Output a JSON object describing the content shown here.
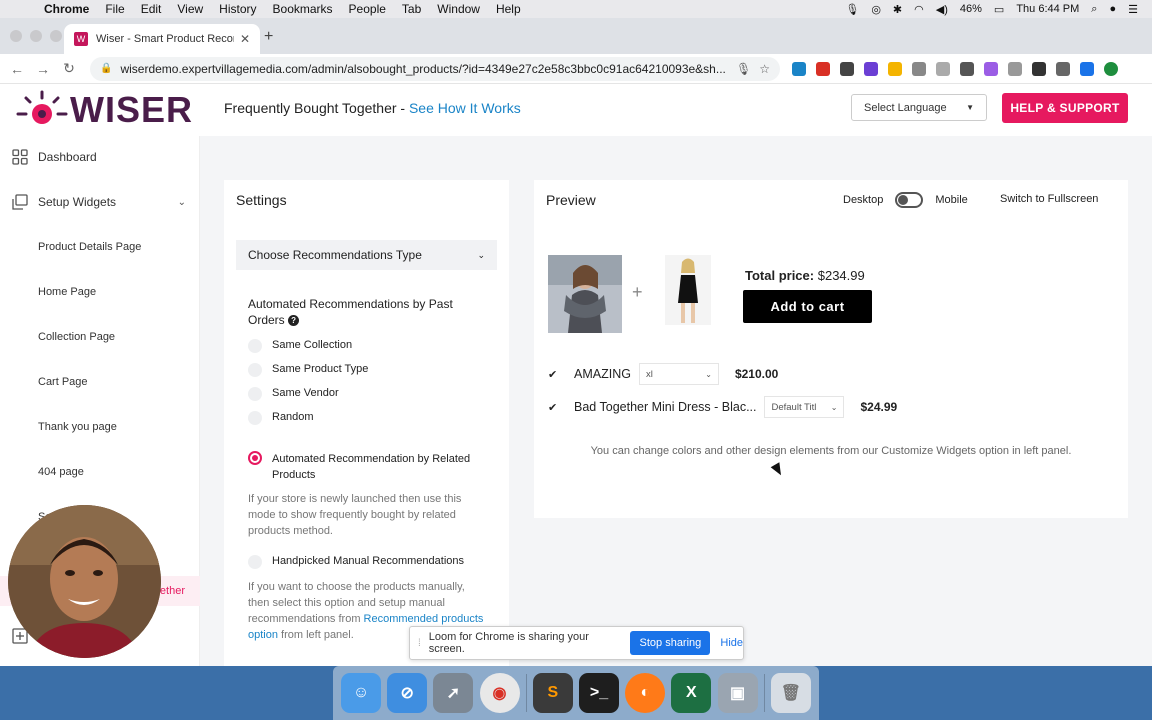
{
  "menubar": {
    "app": "Chrome",
    "items": [
      "File",
      "Edit",
      "View",
      "History",
      "Bookmarks",
      "People",
      "Tab",
      "Window",
      "Help"
    ],
    "battery": "46%",
    "clock": "Thu 6:44 PM"
  },
  "browser": {
    "tab_title": "Wiser - Smart Product Recomm",
    "url": "wiserdemo.expertvillagemedia.com/admin/alsobought_products/?id=4349e27c2e58c3bbc0c91ac64210093e&sh..."
  },
  "header": {
    "logo_text": "WISER",
    "title": "Frequently Bought Together - ",
    "title_link": "See How It Works",
    "language_select": "Select Language",
    "help_button": "HELP & SUPPORT"
  },
  "sidebar": {
    "dashboard": "Dashboard",
    "setup_widgets": "Setup Widgets",
    "items": [
      "Product Details Page",
      "Home Page",
      "Collection Page",
      "Cart Page",
      "Thank you page",
      "404 page"
    ],
    "partial_item": "Se",
    "active_partial": "ether",
    "bottom_partial": "Po"
  },
  "settings": {
    "title": "Settings",
    "dropdown": "Choose Recommendations Type",
    "group_title": "Automated Recommendations by Past Orders",
    "help_icon": "?",
    "past_options": [
      "Same Collection",
      "Same Product Type",
      "Same Vendor",
      "Random"
    ],
    "related_option": "Automated Recommendation by Related Products",
    "related_help": "If your store is newly launched then use this mode to show frequently bought by related products method.",
    "manual_option": "Handpicked Manual Recommendations",
    "manual_help_1": "If you want to choose the products manually, then select this option and setup manual recommendations from ",
    "manual_help_link": "Recommended products option",
    "manual_help_2": " from left panel."
  },
  "preview": {
    "title": "Preview",
    "desktop": "Desktop",
    "mobile": "Mobile",
    "fullscreen": "Switch to Fullscreen",
    "plus": "+",
    "total_label": "Total price:",
    "total_value": "$234.99",
    "add_to_cart": "Add to cart",
    "products": [
      {
        "name": "AMAZING",
        "variant": "xl",
        "price": "$210.00"
      },
      {
        "name": "Bad Together Mini Dress - Blac...",
        "variant": "Default Titl",
        "price": "$24.99"
      }
    ],
    "note": "You can change colors and other design elements from our Customize Widgets option in left panel."
  },
  "loom": {
    "message": "Loom for Chrome is sharing your screen.",
    "stop": "Stop sharing",
    "hide": "Hide"
  },
  "colors": {
    "brand_pink": "#e6195f",
    "brand_purple": "#4a1d4a",
    "link_blue": "#1a84c7"
  }
}
